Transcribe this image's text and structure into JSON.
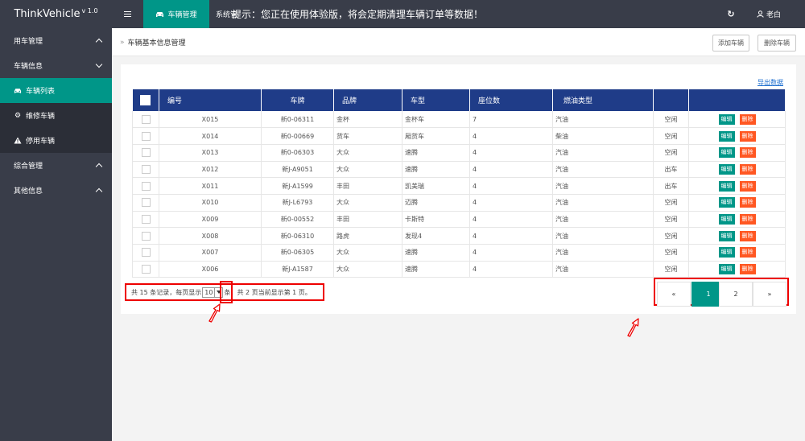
{
  "app": {
    "name": "ThinkVehicle",
    "version": "v 1.0"
  },
  "topbar": {
    "active_tab": "车辆管理",
    "tab2": "系统管",
    "notice": "提示：您正在使用体验版，将会定期清理车辆订单等数据！",
    "user": "老白"
  },
  "sidebar": {
    "groups": [
      {
        "label": "用车管理"
      },
      {
        "label": "车辆信息"
      }
    ],
    "subitems": [
      {
        "label": "车辆列表",
        "icon": "car-icon"
      },
      {
        "label": "维修车辆",
        "icon": "gear-icon"
      },
      {
        "label": "停用车辆",
        "icon": "warning-icon"
      }
    ],
    "groups_after": [
      {
        "label": "综合管理"
      },
      {
        "label": "其他信息"
      }
    ]
  },
  "breadcrumb": {
    "title": "车辆基本信息管理"
  },
  "actions": {
    "add": "添加车辆",
    "delete": "删除车辆"
  },
  "export_label": "导出数据",
  "table": {
    "columns": [
      "编号",
      "车牌",
      "品牌",
      "车型",
      "座位数",
      "燃油类型",
      ""
    ],
    "rows": [
      [
        "X015",
        "新0-06311",
        "金杯",
        "金杯车",
        "7",
        "汽油",
        "空闲"
      ],
      [
        "X014",
        "新0-00669",
        "货车",
        "厢货车",
        "4",
        "柴油",
        "空闲"
      ],
      [
        "X013",
        "新0-06303",
        "大众",
        "速腾",
        "4",
        "汽油",
        "空闲"
      ],
      [
        "X012",
        "新J-A9051",
        "大众",
        "速腾",
        "4",
        "汽油",
        "出车"
      ],
      [
        "X011",
        "新J-A1599",
        "丰田",
        "凯美瑞",
        "4",
        "汽油",
        "出车"
      ],
      [
        "X010",
        "新J-L6793",
        "大众",
        "迈腾",
        "4",
        "汽油",
        "空闲"
      ],
      [
        "X009",
        "新0-00552",
        "丰田",
        "卡斯特",
        "4",
        "汽油",
        "空闲"
      ],
      [
        "X008",
        "新0-06310",
        "路虎",
        "发现4",
        "4",
        "汽油",
        "空闲"
      ],
      [
        "X007",
        "新0-06305",
        "大众",
        "速腾",
        "4",
        "汽油",
        "空闲"
      ],
      [
        "X006",
        "新J-A1587",
        "大众",
        "速腾",
        "4",
        "汽油",
        "空闲"
      ]
    ],
    "edit_label": "编辑",
    "delete_label": "删除"
  },
  "paging": {
    "before": "共 15 条记录，每页显示",
    "page_size": "10",
    "after": "条，共 2 页当前显示第 1 页。",
    "prev": "«",
    "pages": [
      "1",
      "2"
    ],
    "next": "»"
  },
  "colors": {
    "accent": "#009688",
    "header": "#1f3c88",
    "danger": "#ff5722",
    "topbar": "#393d49"
  }
}
